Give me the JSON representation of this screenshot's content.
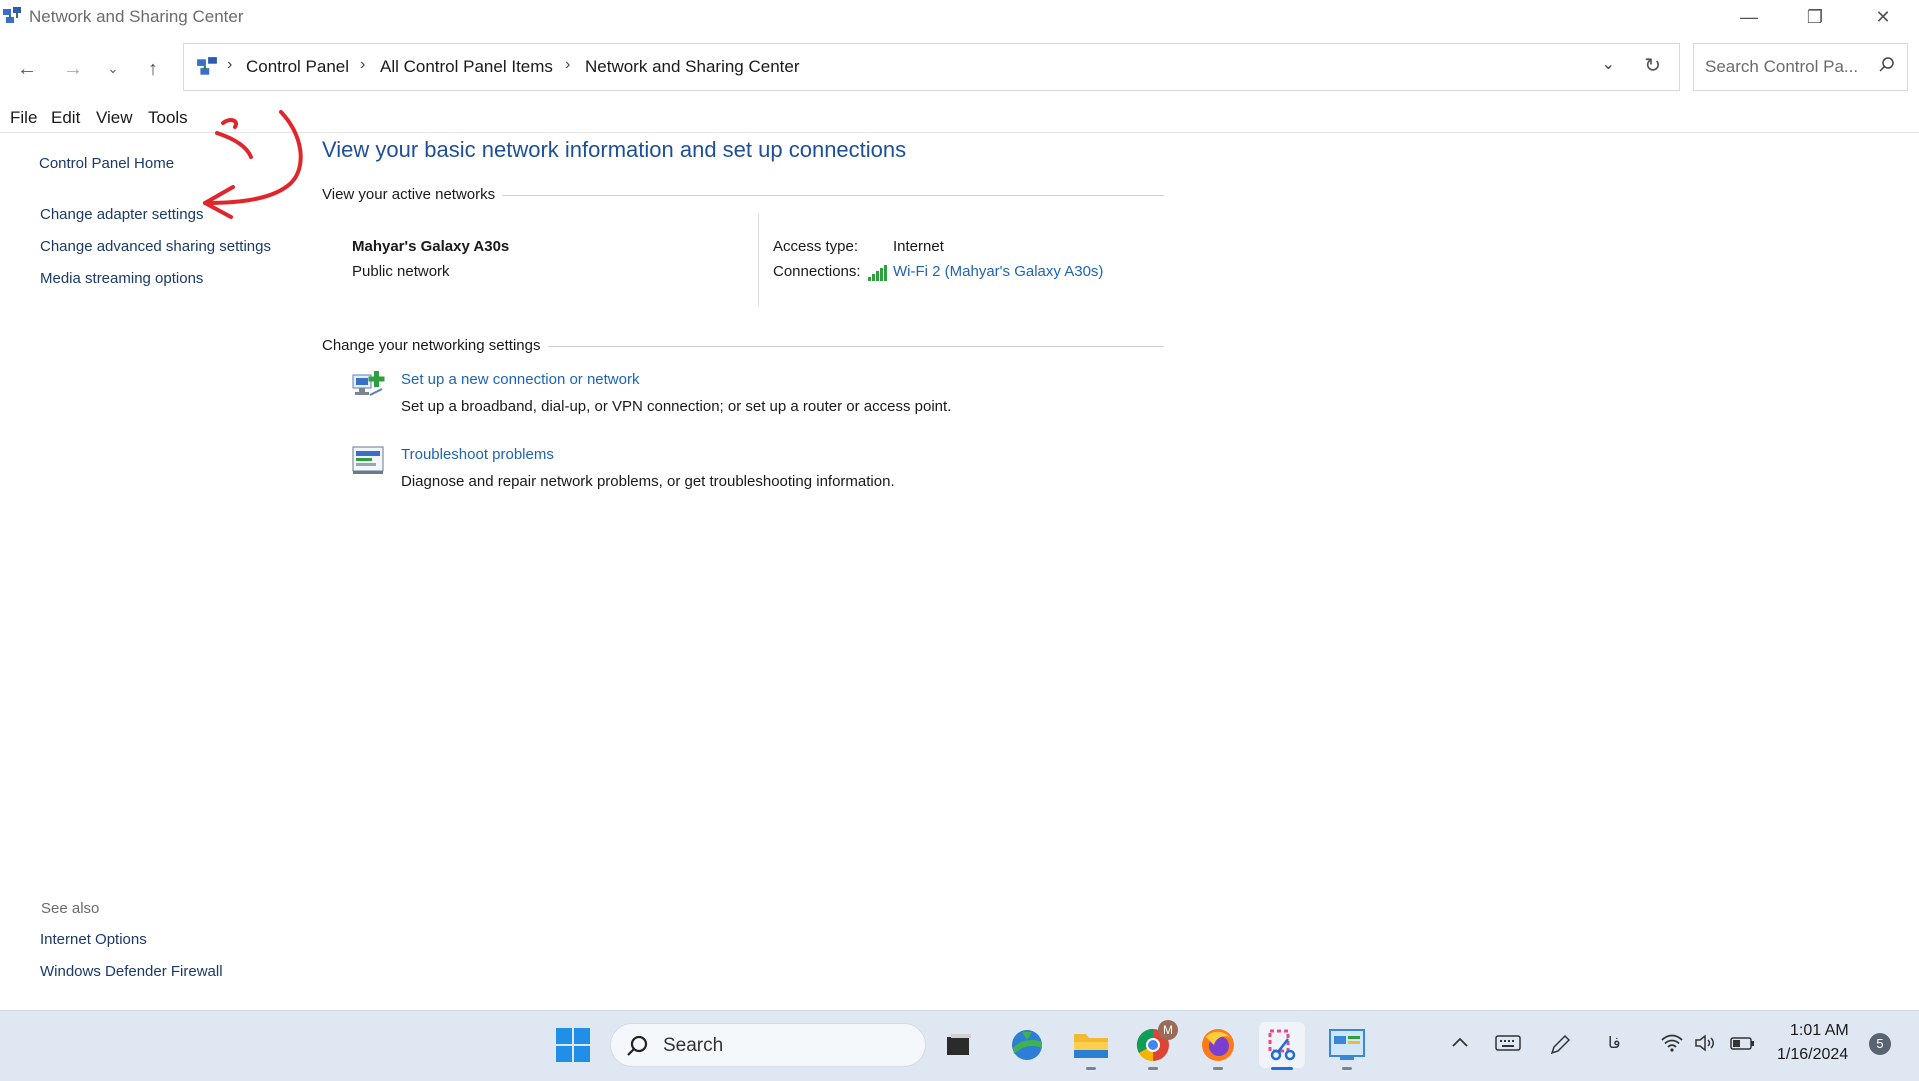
{
  "window": {
    "title": "Network and Sharing Center",
    "controls": [
      "minimize",
      "restore",
      "close"
    ]
  },
  "address": {
    "crumbs": [
      "Control Panel",
      "All Control Panel Items",
      "Network and Sharing Center"
    ],
    "search_placeholder": "Search Control Pa..."
  },
  "menu": [
    "File",
    "Edit",
    "View",
    "Tools"
  ],
  "sidebar": {
    "home": "Control Panel Home",
    "links": [
      "Change adapter settings",
      "Change advanced sharing settings",
      "Media streaming options"
    ],
    "see_also_label": "See also",
    "see_also": [
      "Internet Options",
      "Windows Defender Firewall"
    ]
  },
  "main": {
    "heading": "View your basic network information and set up connections",
    "active_networks_label": "View your active networks",
    "network": {
      "name": "Mahyar's Galaxy A30s",
      "type": "Public network",
      "access_type_label": "Access type:",
      "access_type_value": "Internet",
      "connections_label": "Connections:",
      "connection_value": "Wi-Fi 2 (Mahyar's Galaxy A30s)"
    },
    "change_settings_label": "Change your networking settings",
    "tasks": [
      {
        "title": "Set up a new connection or network",
        "desc": "Set up a broadband, dial-up, or VPN connection; or set up a router or access point.",
        "icon": "new-connection-icon"
      },
      {
        "title": "Troubleshoot problems",
        "desc": "Diagnose and repair network problems, or get troubleshooting information.",
        "icon": "troubleshoot-icon"
      }
    ]
  },
  "taskbar": {
    "search_label": "Search",
    "chrome_badge": "M",
    "clock_time": "1:01 AM",
    "clock_date": "1/16/2024",
    "lang": "فا",
    "notification_count": "5"
  },
  "colors": {
    "link": "#1e64b4",
    "heading": "#1e4f9a",
    "annotation": "#e0262b",
    "taskbar": "#dfe8f2"
  }
}
